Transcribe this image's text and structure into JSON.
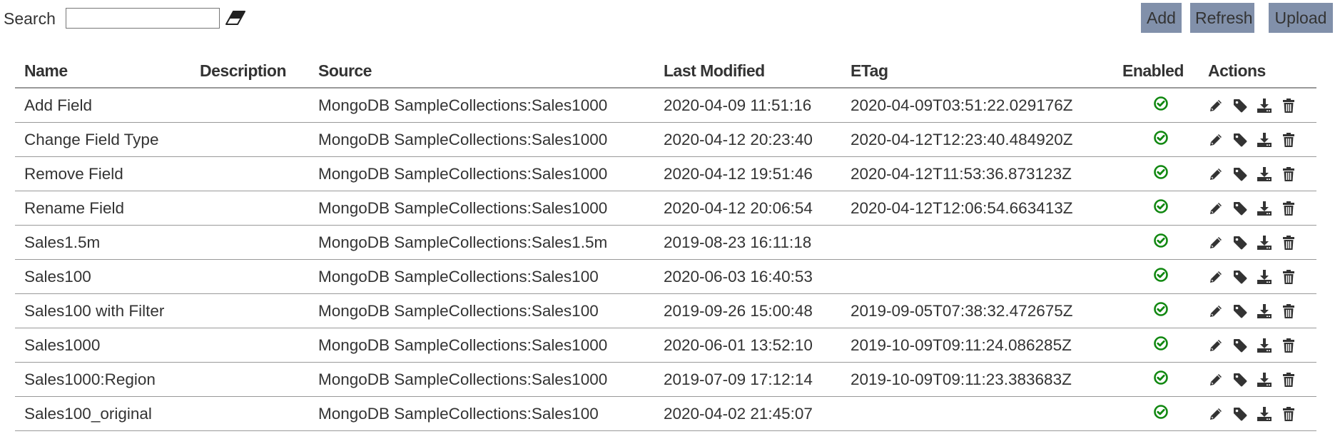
{
  "toolbar": {
    "search_label": "Search",
    "search_value": "",
    "search_placeholder": "",
    "clear_icon": "eraser-icon",
    "add_label": "Add",
    "refresh_label": "Refresh",
    "upload_label": "Upload",
    "button_color": "#8190aa"
  },
  "table": {
    "columns": [
      "Name",
      "Description",
      "Source",
      "Last Modified",
      "ETag",
      "Enabled",
      "Actions"
    ],
    "enabled_icon": "check-circle-icon",
    "enabled_color": "#118811",
    "action_icons": [
      "pencil-icon",
      "tag-icon",
      "download-icon",
      "trash-icon"
    ],
    "rows": [
      {
        "name": "Add Field",
        "description": "",
        "source": "MongoDB SampleCollections:Sales1000",
        "last_modified": "2020-04-09 11:51:16",
        "etag": "2020-04-09T03:51:22.029176Z",
        "enabled": true
      },
      {
        "name": "Change Field Type",
        "description": "",
        "source": "MongoDB SampleCollections:Sales1000",
        "last_modified": "2020-04-12 20:23:40",
        "etag": "2020-04-12T12:23:40.484920Z",
        "enabled": true
      },
      {
        "name": "Remove Field",
        "description": "",
        "source": "MongoDB SampleCollections:Sales1000",
        "last_modified": "2020-04-12 19:51:46",
        "etag": "2020-04-12T11:53:36.873123Z",
        "enabled": true
      },
      {
        "name": "Rename Field",
        "description": "",
        "source": "MongoDB SampleCollections:Sales1000",
        "last_modified": "2020-04-12 20:06:54",
        "etag": "2020-04-12T12:06:54.663413Z",
        "enabled": true
      },
      {
        "name": "Sales1.5m",
        "description": "",
        "source": "MongoDB SampleCollections:Sales1.5m",
        "last_modified": "2019-08-23 16:11:18",
        "etag": "",
        "enabled": true
      },
      {
        "name": "Sales100",
        "description": "",
        "source": "MongoDB SampleCollections:Sales100",
        "last_modified": "2020-06-03 16:40:53",
        "etag": "",
        "enabled": true
      },
      {
        "name": "Sales100 with Filter",
        "description": "",
        "source": "MongoDB SampleCollections:Sales100",
        "last_modified": "2019-09-26 15:00:48",
        "etag": "2019-09-05T07:38:32.472675Z",
        "enabled": true
      },
      {
        "name": "Sales1000",
        "description": "",
        "source": "MongoDB SampleCollections:Sales1000",
        "last_modified": "2020-06-01 13:52:10",
        "etag": "2019-10-09T09:11:24.086285Z",
        "enabled": true
      },
      {
        "name": "Sales1000:Region",
        "description": "",
        "source": "MongoDB SampleCollections:Sales1000",
        "last_modified": "2019-07-09 17:12:14",
        "etag": "2019-10-09T09:11:23.383683Z",
        "enabled": true
      },
      {
        "name": "Sales100_original",
        "description": "",
        "source": "MongoDB SampleCollections:Sales100",
        "last_modified": "2020-04-02 21:45:07",
        "etag": "",
        "enabled": true
      }
    ]
  }
}
